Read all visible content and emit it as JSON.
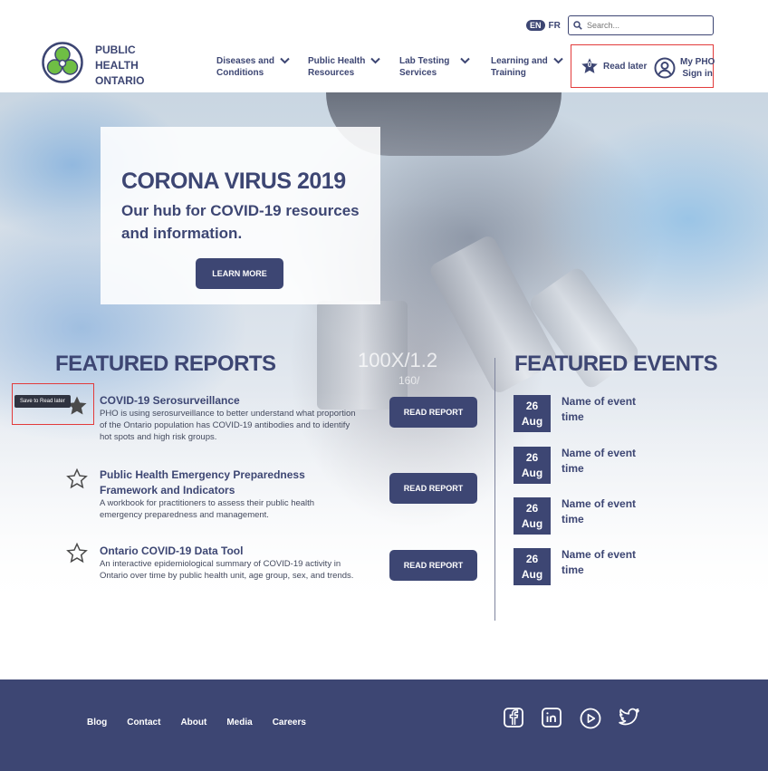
{
  "header": {
    "lang": {
      "en": "EN",
      "fr": "FR"
    },
    "search_placeholder": "Search...",
    "logo": {
      "line1": "PUBLIC",
      "line2": "HEALTH",
      "line3": "ONTARIO"
    },
    "nav": [
      {
        "label": "Diseases and\nConditions"
      },
      {
        "label": "Public Health\nResources"
      },
      {
        "label": "Lab Testing\nServices"
      },
      {
        "label": "Learning and\nTraining"
      }
    ],
    "read_later": {
      "count": "0",
      "label": "Read later"
    },
    "my_pho": {
      "line1": "My PHO",
      "line2": "Sign in"
    }
  },
  "hero": {
    "title": "CORONA VIRUS 2019",
    "subtitle": "Our hub for COVID-19 resources and information.",
    "button": "LEARN MORE",
    "bg_text1": "100X/1.2",
    "bg_text2": "160/"
  },
  "featured_reports": {
    "title": "FEATURED REPORTS",
    "tooltip": "Save to Read later",
    "items": [
      {
        "title": "COVID-19 Serosurveillance",
        "desc": "PHO is using serosurveillance to better understand what proportion of the Ontario population has COVID-19 antibodies and to identify hot spots and high risk groups.",
        "button": "READ REPORT",
        "saved": true
      },
      {
        "title": "Public Health Emergency Preparedness Framework and Indicators",
        "desc": "A workbook for practitioners to assess their public health emergency preparedness and management.",
        "button": "READ REPORT",
        "saved": false
      },
      {
        "title": "Ontario COVID-19 Data Tool",
        "desc": "An interactive epidemiological summary of COVID-19 activity in Ontario over time by public health unit, age group, sex, and trends.",
        "button": "READ REPORT",
        "saved": false
      }
    ]
  },
  "featured_events": {
    "title": "FEATURED EVENTS",
    "items": [
      {
        "day": "26",
        "month": "Aug",
        "name": "Name of event",
        "time": "time"
      },
      {
        "day": "26",
        "month": "Aug",
        "name": "Name of event",
        "time": "time"
      },
      {
        "day": "26",
        "month": "Aug",
        "name": "Name of event",
        "time": "time"
      },
      {
        "day": "26",
        "month": "Aug",
        "name": "Name of event",
        "time": "time"
      }
    ]
  },
  "footer": {
    "links": [
      "Blog",
      "Contact",
      "About",
      "Media",
      "Careers"
    ],
    "social_icons": [
      "facebook-icon",
      "linkedin-icon",
      "youtube-icon",
      "twitter-icon"
    ]
  },
  "colors": {
    "primary": "#3d4673",
    "logo_green": "#6fbe44",
    "highlight_red": "#e23b3b"
  }
}
